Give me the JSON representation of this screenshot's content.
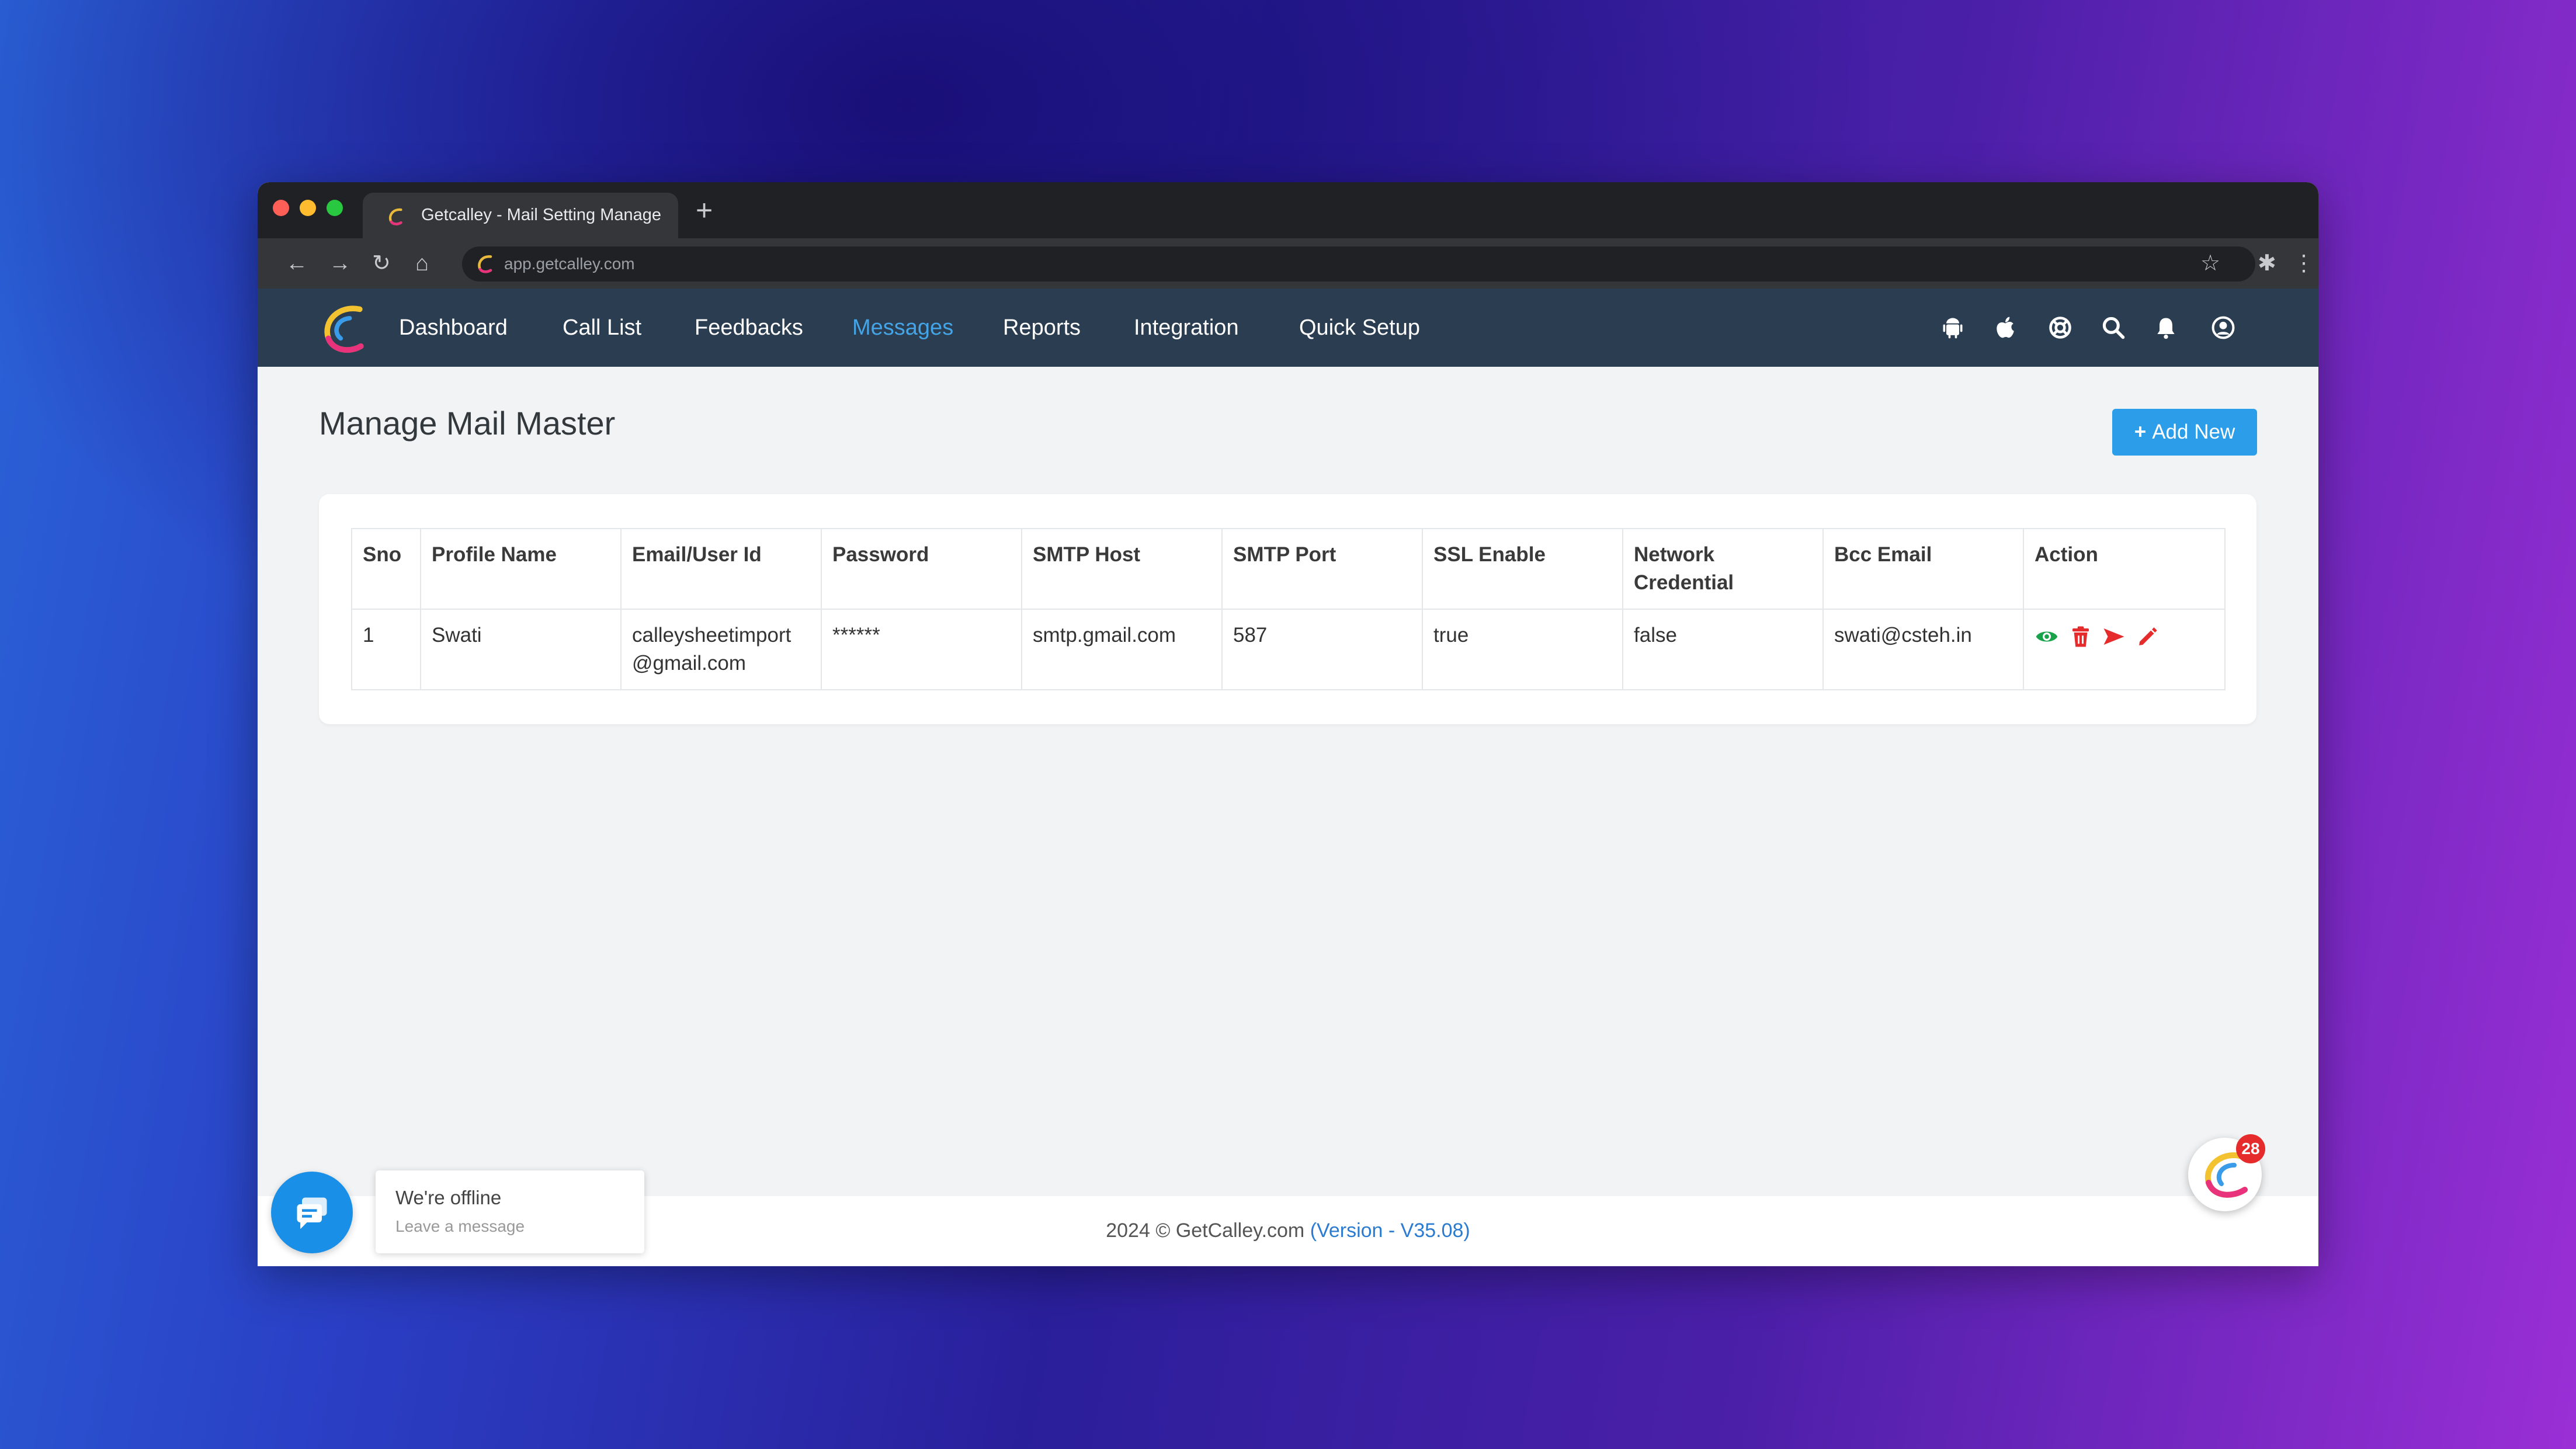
{
  "browser": {
    "tab_title": "Getcalley - Mail Setting Manage",
    "new_tab": "+",
    "url": "app.getcalley.com"
  },
  "nav": {
    "items": [
      "Dashboard",
      "Call List",
      "Feedbacks",
      "Messages",
      "Reports",
      "Integration",
      "Quick Setup"
    ],
    "active": "Messages",
    "icons": [
      "android-icon",
      "apple-icon",
      "support-icon",
      "search-icon",
      "bell-icon",
      "user-icon"
    ]
  },
  "page": {
    "title": "Manage Mail Master",
    "add_button": "Add New"
  },
  "table": {
    "headers": [
      "Sno",
      "Profile Name",
      "Email/User Id",
      "Password",
      "SMTP Host",
      "SMTP Port",
      "SSL Enable",
      "Network Credential",
      "Bcc Email",
      "Action"
    ],
    "rows": [
      {
        "sno": "1",
        "profile_name": "Swati",
        "email": "calleysheetimport@gmail.com",
        "password": "******",
        "smtp_host": "smtp.gmail.com",
        "smtp_port": "587",
        "ssl_enable": "true",
        "network_credential": "false",
        "bcc_email": "swati@csteh.in",
        "actions": [
          "view-icon",
          "delete-icon",
          "send-icon",
          "edit-icon"
        ]
      }
    ]
  },
  "footer": {
    "copyright": "2024 © GetCalley.com",
    "version": "(Version - V35.08)"
  },
  "chat": {
    "title": "We're offline",
    "subtitle": "Leave a message"
  },
  "fab_badge": "28",
  "colors": {
    "nav_bg": "#2b3d50",
    "active_nav": "#45a4e6",
    "primary": "#2b9de9",
    "view_green": "#18a34a",
    "action_red": "#e52b2b"
  }
}
